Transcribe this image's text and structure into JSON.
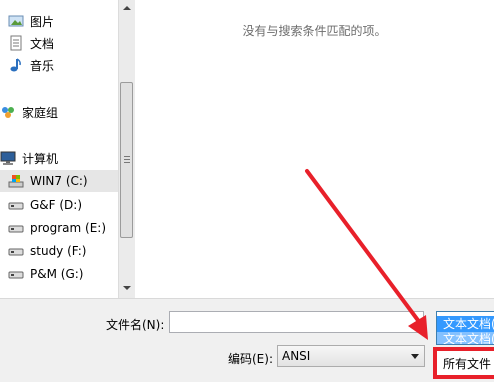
{
  "nav": {
    "items": [
      {
        "label": "图片",
        "icon": "pictures-icon"
      },
      {
        "label": "文档",
        "icon": "documents-icon"
      },
      {
        "label": "音乐",
        "icon": "music-icon"
      },
      {
        "label": "家庭组",
        "icon": "homegroup-icon"
      },
      {
        "label": "计算机",
        "icon": "computer-icon"
      },
      {
        "label": "WIN7 (C:)",
        "icon": "system-drive-icon"
      },
      {
        "label": "G&F (D:)",
        "icon": "drive-icon"
      },
      {
        "label": "program (E:)",
        "icon": "drive-icon"
      },
      {
        "label": "study (F:)",
        "icon": "drive-icon"
      },
      {
        "label": "P&M (G:)",
        "icon": "drive-icon"
      }
    ]
  },
  "content": {
    "empty_message": "没有与搜索条件匹配的项。"
  },
  "bottom": {
    "filename_label": "文件名(N):",
    "filename_value": "",
    "encoding_label": "编码(E):",
    "encoding_value": "ANSI",
    "filetype_option_1": "文本文档(",
    "filetype_option_2": "文本文档(",
    "filetype_highlighted": "所有文件"
  },
  "colors": {
    "accent": "#3399ff",
    "highlight_border": "#e8202a",
    "arrow": "#e8202a"
  }
}
